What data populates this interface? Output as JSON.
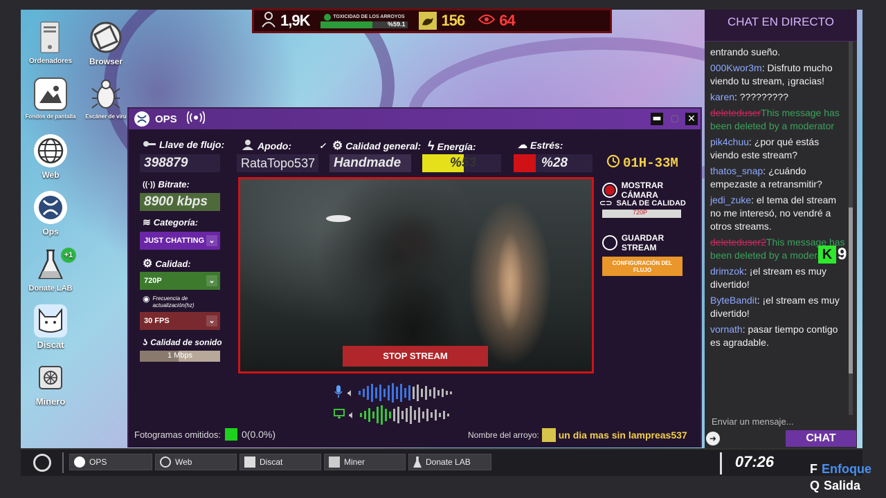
{
  "desktop": {
    "icons": [
      {
        "label": "Ordenadores",
        "name": "computers-icon"
      },
      {
        "label": "Browser",
        "name": "browser-icon"
      },
      {
        "label": "Fondos de pantalla",
        "name": "wallpapers-icon"
      },
      {
        "label": "Escáner de viru",
        "name": "virus-scanner-icon"
      },
      {
        "label": "Web",
        "name": "web-icon"
      },
      {
        "label": "Ops",
        "name": "ops-icon"
      },
      {
        "label": "Donate LAB",
        "name": "donate-lab-icon"
      },
      {
        "label": "Discat",
        "name": "discat-icon"
      },
      {
        "label": "Minero",
        "name": "miner-icon"
      }
    ],
    "donate_badge": "+1"
  },
  "hud": {
    "followers": "1,9K",
    "toxicity_label": "TOXICIDAD DE LOS ARROYOS",
    "toxicity_value": "%59.1",
    "toxicity_fraction": 0.591,
    "rats": "156",
    "views": "64"
  },
  "ops": {
    "title": "OPS",
    "stream_key_label": "Llave de flujo:",
    "stream_key": "398879",
    "nick_label": "Apodo:",
    "nick": "RataTopo537",
    "quality_label": "Calidad general:",
    "quality": "Handmade",
    "energy_label": "Energía:",
    "energy": "%53",
    "energy_fraction": 0.53,
    "stress_label": "Estrés:",
    "stress": "%28",
    "stress_fraction": 0.28,
    "timer": "01H-33M",
    "bitrate_label": "Bitrate:",
    "bitrate": "8900 kbps",
    "category_label": "Categoría:",
    "category": "JUST CHATTING",
    "video_quality_label": "Calidad:",
    "video_quality": "720P",
    "refresh_label": "Frecuencia de actualización(hz)",
    "refresh": "30 FPS",
    "sound_label": "Calidad de sonido",
    "sound": "1 Mbps",
    "stop_stream": "STOP STREAM",
    "show_camera": "MOSTRAR CÁMARA",
    "quality_room": "SALA DE CALIDAD",
    "quality_room_value": "720P",
    "save_stream": "GUARDAR STREAM",
    "stream_config": "CONFIGURACIÓN DEL FLUJO",
    "dropped_frames_label": "Fotogramas omitidos:",
    "dropped_frames": "0(0.0%)",
    "stream_name_label": "Nombre del arroyo:",
    "stream_name": "un dia mas sin lampreas537"
  },
  "chat": {
    "title": "CHAT EN DIRECTO",
    "messages": [
      {
        "user": "",
        "text": "entrando sueño."
      },
      {
        "user": "000Kwor3m",
        "text": ": Disfruto mucho viendo tu stream, ¡gracias!"
      },
      {
        "user": "karen",
        "text": ": ?????????"
      },
      {
        "user": "deleteduser",
        "text": "This message has been deleted by a moderator",
        "deleted": true
      },
      {
        "user": "pik4chuu",
        "text": ": ¿por qué estás viendo este stream?"
      },
      {
        "user": "thatos_snap",
        "text": ": ¿cuándo empezaste a retransmitir?"
      },
      {
        "user": "jedi_zuke",
        "text": ": el tema del stream no me interesó, no vendré a otros streams."
      },
      {
        "user": "deleteduser2",
        "text": "This message has been deleted by a moderator",
        "deleted": true
      },
      {
        "user": "drimzok",
        "text": ": ¡el stream es muy divertido!"
      },
      {
        "user": "ByteBandit",
        "text": ": ¡el stream es muy divertido!"
      },
      {
        "user": "vornath",
        "text": ": pasar tiempo contigo es agradable."
      }
    ],
    "input_placeholder": "Enviar un mensaje...",
    "send": "CHAT",
    "k_counter": "9"
  },
  "taskbar": {
    "items": [
      "OPS",
      "Web",
      "Discat",
      "Miner",
      "Donate LAB"
    ],
    "clock": "07:26"
  },
  "hints": {
    "focus_key": "F",
    "focus_label": "Enfoque",
    "exit_key": "Q",
    "exit_label": "Salida"
  }
}
